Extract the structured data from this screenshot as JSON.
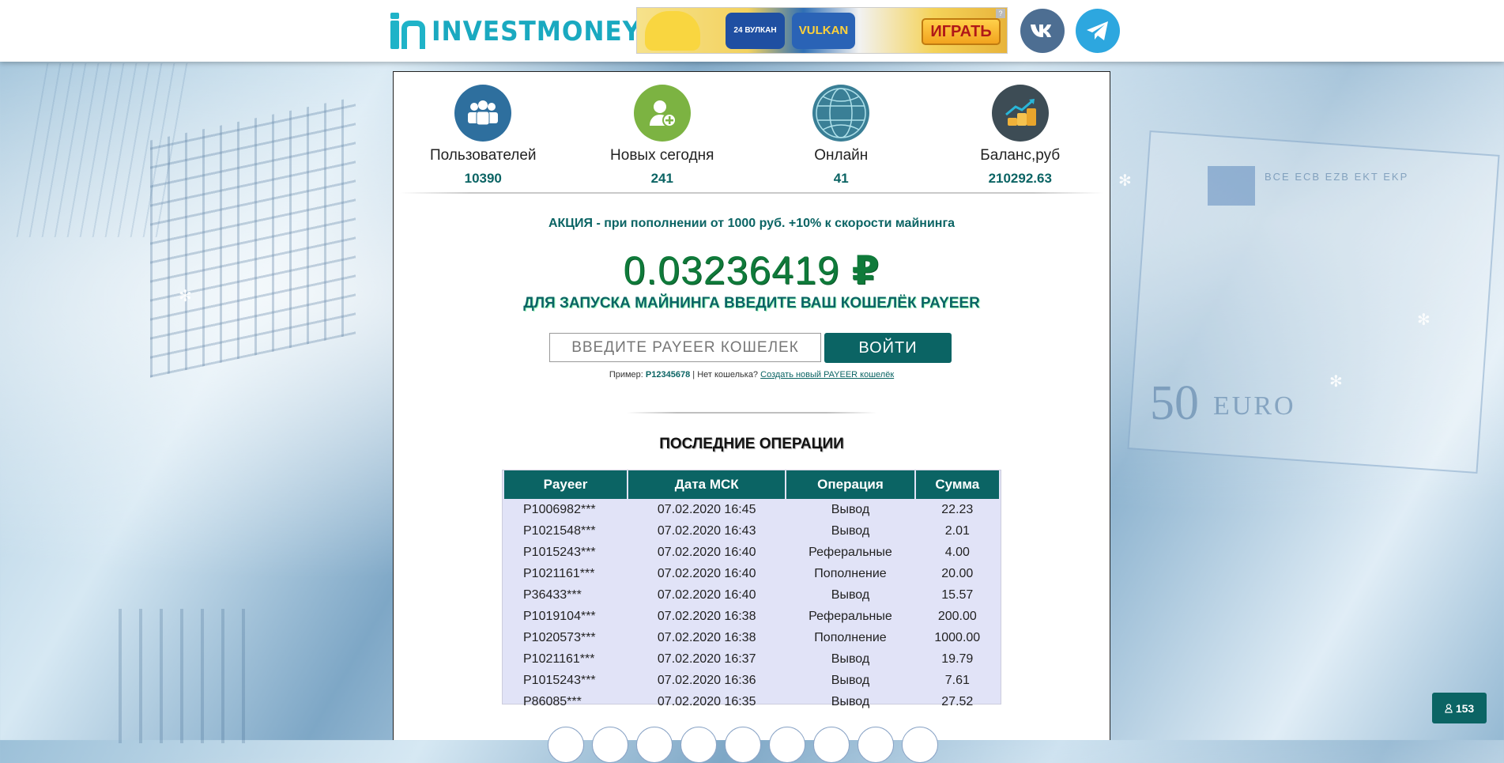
{
  "header": {
    "logo_text": "INVESTMONEY",
    "banner": {
      "badge_text": "24 ВУЛКАН",
      "brand_text": "VULKAN GO",
      "play_label": "ИГРАТЬ",
      "ad_marker": "?"
    },
    "social": [
      {
        "name": "vk",
        "icon": "vk-icon",
        "color": "#4d6e92"
      },
      {
        "name": "telegram",
        "icon": "telegram-icon",
        "color": "#2da7df"
      }
    ]
  },
  "stats": [
    {
      "label": "Пользователей",
      "value": "10390",
      "icon": "users-icon",
      "color": "#2e6f9e"
    },
    {
      "label": "Новых сегодня",
      "value": "241",
      "icon": "user-plus-icon",
      "color": "#7cb342"
    },
    {
      "label": "Онлайн",
      "value": "41",
      "icon": "globe-icon",
      "color": "#3a7f96"
    },
    {
      "label": "Баланс,руб",
      "value": "210292.63",
      "icon": "coins-growth-icon",
      "color": "#3d4c55"
    }
  ],
  "promo": "АКЦИЯ - при пополнении от 1000 руб. +10% к скорости майнинга",
  "balance": {
    "amount": "0.03236419",
    "currency": "₽"
  },
  "subtitle": "ДЛЯ ЗАПУСКА МАЙНИНГА ВВЕДИТЕ ВАШ КОШЕЛЁК PAYEER",
  "login": {
    "placeholder": "ВВЕДИТЕ PAYEER КОШЕЛЕК",
    "value": "",
    "button": "ВОЙТИ",
    "hint_prefix": "Пример:",
    "hint_example": "P12345678",
    "hint_sep": "|",
    "hint_no_wallet": "Нет кошелька?",
    "hint_link": "Создать новый PAYEER кошелёк"
  },
  "operations": {
    "title": "ПОСЛЕДНИЕ ОПЕРАЦИИ",
    "columns": [
      "Payeer",
      "Дата МСК",
      "Операция",
      "Сумма"
    ],
    "rows": [
      [
        "P1006982***",
        "07.02.2020 16:45",
        "Вывод",
        "22.23"
      ],
      [
        "P1021548***",
        "07.02.2020 16:43",
        "Вывод",
        "2.01"
      ],
      [
        "P1015243***",
        "07.02.2020 16:40",
        "Реферальные",
        "4.00"
      ],
      [
        "P1021161***",
        "07.02.2020 16:40",
        "Пополнение",
        "20.00"
      ],
      [
        "P36433***",
        "07.02.2020 16:40",
        "Вывод",
        "15.57"
      ],
      [
        "P1019104***",
        "07.02.2020 16:38",
        "Реферальные",
        "200.00"
      ],
      [
        "P1020573***",
        "07.02.2020 16:38",
        "Пополнение",
        "1000.00"
      ],
      [
        "P1021161***",
        "07.02.2020 16:37",
        "Вывод",
        "19.79"
      ],
      [
        "P1015243***",
        "07.02.2020 16:36",
        "Вывод",
        "7.61"
      ],
      [
        "P86085***",
        "07.02.2020 16:35",
        "Вывод",
        "27.52"
      ]
    ]
  },
  "share_icons": [
    "vk-share-icon",
    "facebook-share-icon",
    "twitter-share-icon",
    "odnoklassniki-share-icon",
    "mailru-share-icon",
    "telegram-share-icon",
    "email-share-icon",
    "livejournal-share-icon",
    "more-share-icon"
  ],
  "online_badge": {
    "icon": "user-icon",
    "count": "153"
  },
  "colors": {
    "primary": "#0b6464",
    "balance": "#0f7a3a",
    "table_bg": "#e1e3f7"
  }
}
